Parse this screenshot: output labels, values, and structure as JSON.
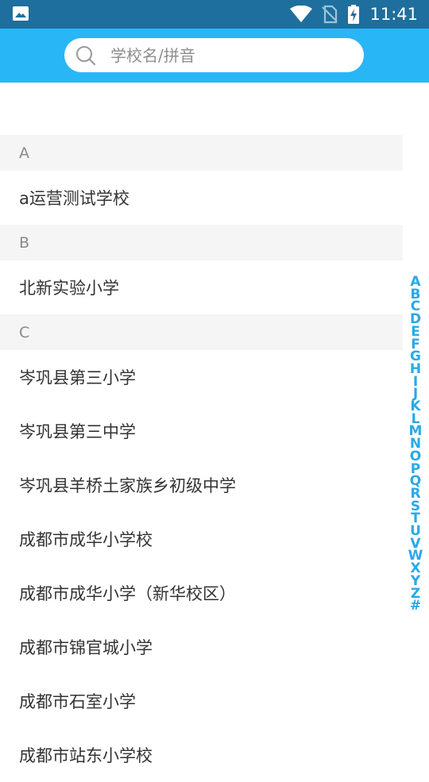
{
  "status_bar": {
    "time": "11:41"
  },
  "search": {
    "placeholder": "学校名/拼音"
  },
  "sections": [
    {
      "letter": "A",
      "schools": [
        "a运营测试学校"
      ]
    },
    {
      "letter": "B",
      "schools": [
        "北新实验小学"
      ]
    },
    {
      "letter": "C",
      "schools": [
        "岑巩县第三小学",
        "岑巩县第三中学",
        "岑巩县羊桥土家族乡初级中学",
        "成都市成华小学校",
        "成都市成华小学（新华校区）",
        "成都市锦官城小学",
        "成都市石室小学",
        "成都市站东小学校"
      ]
    }
  ],
  "index_letters": [
    "A",
    "B",
    "C",
    "D",
    "E",
    "F",
    "G",
    "H",
    "I",
    "J",
    "K",
    "L",
    "M",
    "N",
    "O",
    "P",
    "Q",
    "R",
    "S",
    "T",
    "U",
    "V",
    "W",
    "X",
    "Y",
    "Z",
    "#"
  ],
  "colors": {
    "status_bar": "#1e6f9e",
    "header": "#29b6f6",
    "index": "#29a9e8"
  }
}
